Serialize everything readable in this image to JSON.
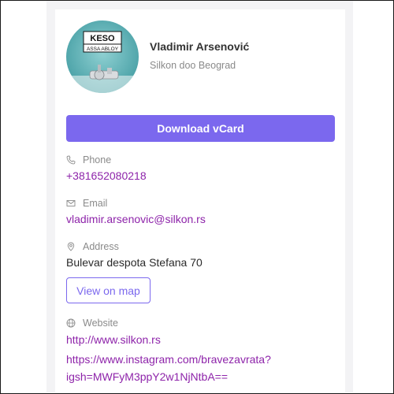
{
  "profile": {
    "name": "Vladimir Arsenović",
    "company": "Silkon doo Beograd",
    "avatar_logo_top": "KESO",
    "avatar_logo_bottom": "ASSA ABLOY"
  },
  "actions": {
    "download_vcard": "Download vCard",
    "view_on_map": "View on map"
  },
  "phone": {
    "label": "Phone",
    "value": "+381652080218"
  },
  "email": {
    "label": "Email",
    "value": "vladimir.arsenovic@silkon.rs"
  },
  "address": {
    "label": "Address",
    "value": "Bulevar despota Stefana 70"
  },
  "website": {
    "label": "Website",
    "links": [
      "http://www.silkon.rs",
      "https://www.instagram.com/bravezavrata?",
      "igsh=MWFyM3ppY2w1NjNtbA=="
    ]
  },
  "colors": {
    "accent": "#7b68ee",
    "link": "#8e24aa",
    "muted": "#8a8a8a"
  },
  "icons": {
    "phone": "phone-icon",
    "email": "envelope-icon",
    "address": "map-pin-icon",
    "website": "globe-icon"
  }
}
